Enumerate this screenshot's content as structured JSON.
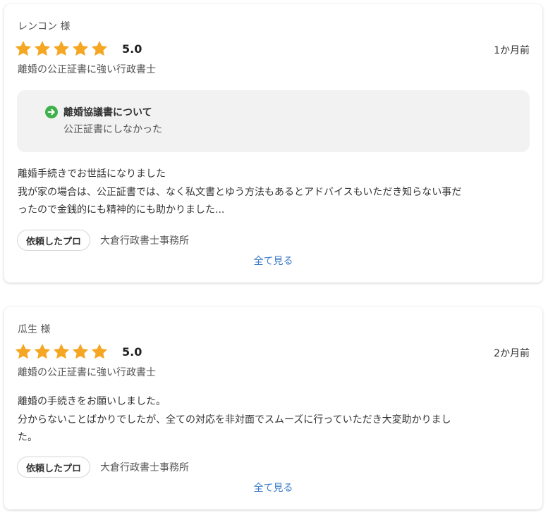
{
  "colors": {
    "star": "#f5a623",
    "link": "#3a7bc8",
    "check": "#3fb04a",
    "box_bg": "#f2f2f2"
  },
  "reviews": [
    {
      "reviewer": "レンコン 様",
      "rating": "5.0",
      "stars": 5,
      "date": "1か月前",
      "service": "離婚の公正証書に強い行政書士",
      "info": {
        "icon": "arrow-right-circle-icon",
        "title": "離婚協議書について",
        "value": "公正証書にしなかった"
      },
      "text_lines": [
        "離婚手続きでお世話になりました",
        "我が家の場合は、公正証書では、なく私文書とゆう方法もあるとアドバイスもいただき知らない事だ",
        "ったので金銭的にも精神的にも助かりました..."
      ],
      "pro_badge": "依頼したプロ",
      "pro_name": "大倉行政書士事務所",
      "see_all": "全て見る"
    },
    {
      "reviewer": "瓜生 様",
      "rating": "5.0",
      "stars": 5,
      "date": "2か月前",
      "service": "離婚の公正証書に強い行政書士",
      "text_lines": [
        "離婚の手続きをお願いしました。",
        "分からないことばかりでしたが、全ての対応を非対面でスムーズに行っていただき大変助かりまし",
        "た。"
      ],
      "pro_badge": "依頼したプロ",
      "pro_name": "大倉行政書士事務所",
      "see_all": "全て見る"
    }
  ]
}
